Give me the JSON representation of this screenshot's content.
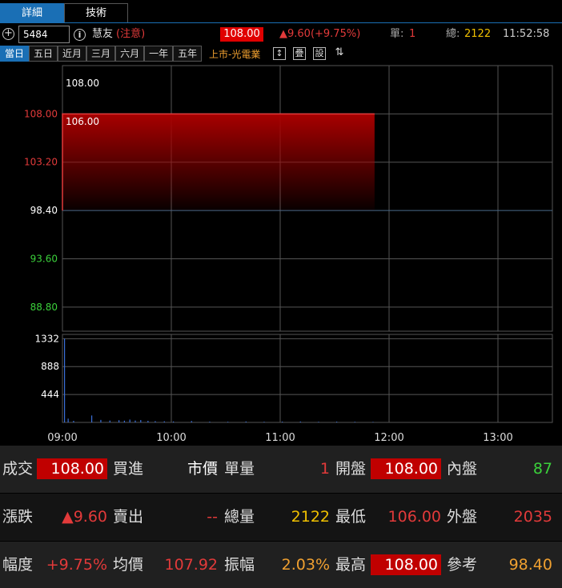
{
  "tabs": [
    {
      "label": "詳細",
      "active": true
    },
    {
      "label": "技術",
      "active": false
    }
  ],
  "quote": {
    "code": "5484",
    "name": "慧友",
    "note": "(注意)",
    "price": "108.00",
    "change": "▲9.60(+9.75%)",
    "vol_label": "單:",
    "vol_value": "1",
    "total_label": "總:",
    "total_value": "2122",
    "time": "11:52:58"
  },
  "periods": [
    {
      "label": "當日",
      "active": true
    },
    {
      "label": "五日",
      "active": false
    },
    {
      "label": "近月",
      "active": false
    },
    {
      "label": "三月",
      "active": false
    },
    {
      "label": "六月",
      "active": false
    },
    {
      "label": "一年",
      "active": false
    },
    {
      "label": "五年",
      "active": false
    }
  ],
  "industry": "上市-光電業",
  "tools": {
    "sort": "↕",
    "overlay": "疊",
    "settings": "設",
    "filter": "⇅"
  },
  "colors": {
    "up": "#e23a3a",
    "down": "#3bd13b",
    "accent": "#1a6fb5",
    "volume": "#3a6fd8",
    "total": "#f0c000"
  },
  "chart_data": {
    "type": "area",
    "price": {
      "ylim": [
        86.4,
        112.8
      ],
      "ticks": [
        {
          "value": 108.0,
          "label": "108.00",
          "color": "#e23a3a"
        },
        {
          "value": 103.2,
          "label": "103.20",
          "color": "#e23a3a"
        },
        {
          "value": 98.4,
          "label": "98.40",
          "color": "#ffffff"
        },
        {
          "value": 93.6,
          "label": "93.60",
          "color": "#3bd13b"
        },
        {
          "value": 88.8,
          "label": "88.80",
          "color": "#3bd13b"
        }
      ],
      "reference": 98.4,
      "high_label": "108.00",
      "low_label": "106.00",
      "series": [
        {
          "t": "09:00",
          "v": 98.4
        },
        {
          "t": "09:00",
          "v": 108.0
        },
        {
          "t": "11:52",
          "v": 108.0
        }
      ]
    },
    "volume": {
      "ylim": [
        0,
        1400
      ],
      "ticks": [
        1332,
        888,
        444
      ],
      "bars": [
        {
          "t": "09:00",
          "v": 1332
        },
        {
          "t": "09:02",
          "v": 60
        },
        {
          "t": "09:05",
          "v": 25
        },
        {
          "t": "09:15",
          "v": 110
        },
        {
          "t": "09:20",
          "v": 40
        },
        {
          "t": "09:25",
          "v": 30
        },
        {
          "t": "09:30",
          "v": 35
        },
        {
          "t": "09:33",
          "v": 28
        },
        {
          "t": "09:36",
          "v": 45
        },
        {
          "t": "09:39",
          "v": 30
        },
        {
          "t": "09:42",
          "v": 38
        },
        {
          "t": "09:46",
          "v": 25
        },
        {
          "t": "09:50",
          "v": 20
        },
        {
          "t": "09:55",
          "v": 18
        },
        {
          "t": "10:00",
          "v": 15
        },
        {
          "t": "10:10",
          "v": 22
        },
        {
          "t": "10:20",
          "v": 12
        },
        {
          "t": "10:30",
          "v": 10
        },
        {
          "t": "10:40",
          "v": 15
        },
        {
          "t": "10:50",
          "v": 10
        },
        {
          "t": "11:00",
          "v": 12
        },
        {
          "t": "11:10",
          "v": 14
        },
        {
          "t": "11:20",
          "v": 10
        },
        {
          "t": "11:30",
          "v": 12
        },
        {
          "t": "11:40",
          "v": 10
        },
        {
          "t": "11:50",
          "v": 8
        }
      ]
    },
    "x_ticks": [
      "09:00",
      "10:00",
      "11:00",
      "12:00",
      "13:00"
    ],
    "x_range": [
      "09:00",
      "13:30"
    ]
  },
  "stats": [
    [
      {
        "label": "成交",
        "value": "108.00",
        "color": "white",
        "boxed": true
      },
      {
        "label": "買進",
        "value": "市價",
        "color": "white",
        "boxed": false
      },
      {
        "label": "單量",
        "value": "1",
        "color": "red",
        "boxed": false
      },
      {
        "label": "開盤",
        "value": "108.00",
        "color": "white",
        "boxed": true
      },
      {
        "label": "內盤",
        "value": "87",
        "color": "green",
        "boxed": false
      }
    ],
    [
      {
        "label": "漲跌",
        "value": "▲9.60",
        "color": "red",
        "boxed": false
      },
      {
        "label": "賣出",
        "value": "--",
        "color": "red",
        "boxed": false
      },
      {
        "label": "總量",
        "value": "2122",
        "color": "yellow",
        "boxed": false
      },
      {
        "label": "最低",
        "value": "106.00",
        "color": "red",
        "boxed": false
      },
      {
        "label": "外盤",
        "value": "2035",
        "color": "red",
        "boxed": false
      }
    ],
    [
      {
        "label": "幅度",
        "value": "+9.75%",
        "color": "red",
        "boxed": false
      },
      {
        "label": "均價",
        "value": "107.92",
        "color": "red",
        "boxed": false
      },
      {
        "label": "振幅",
        "value": "2.03%",
        "color": "orange",
        "boxed": false
      },
      {
        "label": "最高",
        "value": "108.00",
        "color": "white",
        "boxed": true
      },
      {
        "label": "參考",
        "value": "98.40",
        "color": "orange",
        "boxed": false
      }
    ]
  ]
}
